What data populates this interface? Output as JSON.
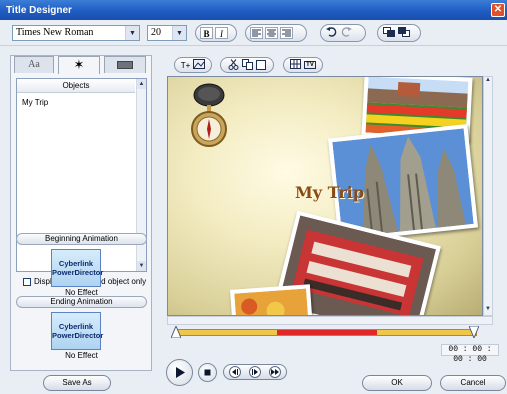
{
  "window": {
    "title": "Title Designer",
    "close_glyph": "✕"
  },
  "toolbar": {
    "font_name": "Times New Roman",
    "font_size": "20",
    "bold_label": "B",
    "italic_label": "I",
    "icons": [
      "align-left-icon",
      "align-center-icon",
      "align-right-icon",
      "undo-icon",
      "redo-icon",
      "bring-front-icon",
      "send-back-icon"
    ]
  },
  "left_panel": {
    "tabs": [
      {
        "label": "Aa",
        "icon": "text-tab-icon"
      },
      {
        "label": "✶",
        "icon": "particle-tab-icon"
      },
      {
        "label": "",
        "icon": "background-tab-icon"
      }
    ],
    "objects_header": "Objects",
    "objects": [
      "My Trip"
    ],
    "display_selected_label": "Display the selected object only",
    "beginning_animation_label": "Beginning Animation",
    "beginning_effect_thumb": "Cyberlink PowerDirector",
    "beginning_effect_name": "No Effect",
    "ending_animation_label": "Ending Animation",
    "ending_effect_thumb": "Cyberlink PowerDirector",
    "ending_effect_name": "No Effect"
  },
  "canvas_toolbar": {
    "insert_text": "T+",
    "icons": [
      "insert-text-icon",
      "insert-image-icon",
      "cut-icon",
      "copy-icon",
      "paste-icon",
      "grid-icon",
      "tv-safe-zone-icon"
    ],
    "tv_label": "TV"
  },
  "canvas": {
    "title_text": "My Trip"
  },
  "timecode": "00 : 00 : 00 : 00",
  "playback": {
    "icons": [
      "play-icon",
      "stop-icon",
      "previous-frame-icon",
      "next-frame-icon",
      "fast-forward-icon"
    ]
  },
  "buttons": {
    "save_as": "Save As",
    "ok": "OK",
    "cancel": "Cancel"
  },
  "colors": {
    "title_bar": "#1f5cc2",
    "title_text": "#8a4a13",
    "timeline_bar": "#f0c64a",
    "timeline_selected": "#e02828"
  }
}
